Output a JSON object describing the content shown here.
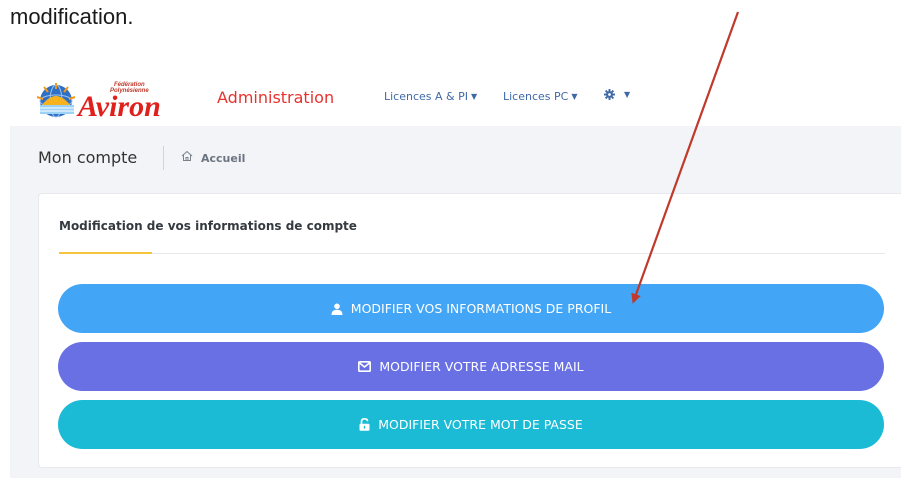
{
  "caption": "modification.",
  "header": {
    "logo_small_1": "Fédération",
    "logo_small_2": "Polynésienne",
    "logo_word": "Aviron",
    "admin_label": "Administration",
    "nav": [
      {
        "label": "Licences A & PI",
        "icon": "chevron-down-icon"
      },
      {
        "label": "Licences PC",
        "icon": "chevron-down-icon"
      },
      {
        "label": "",
        "icon": "gear-icon"
      }
    ]
  },
  "page": {
    "title": "Mon compte",
    "breadcrumb": "Accueil"
  },
  "card": {
    "title": "Modification de vos informations de compte"
  },
  "buttons": [
    {
      "label": "MODIFIER VOS INFORMATIONS DE PROFIL",
      "icon": "user-icon",
      "color": "#43a5f5"
    },
    {
      "label": "MODIFIER VOTRE ADRESSE MAIL",
      "icon": "envelope-icon",
      "color": "#6870e4"
    },
    {
      "label": "MODIFIER VOTRE MOT DE PASSE",
      "icon": "unlock-icon",
      "color": "#1bbbd6"
    }
  ],
  "colors": {
    "accent": "#e8322e",
    "nav_text": "#3f6aa6",
    "tab_underline": "#f4c53d",
    "arrow": "#c0392b"
  }
}
